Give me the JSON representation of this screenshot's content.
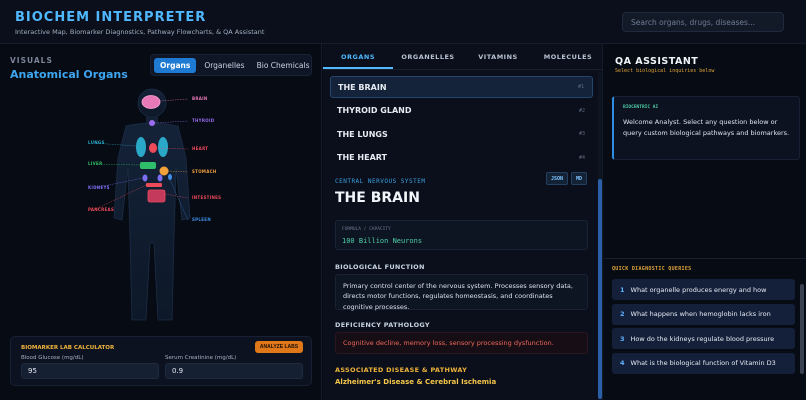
{
  "header": {
    "title": "BIOCHEM INTERPRETER",
    "subtitle": "Interactive Map, Biomarker Diagnostics, Pathway Flowcharts, & QA Assistant",
    "search_placeholder": "Search organs, drugs, diseases..."
  },
  "left": {
    "section_label": "VISUALS",
    "heading": "Anatomical Organs",
    "tabs": [
      "Organs",
      "Organelles",
      "Bio Chemicals"
    ],
    "active_tab": "Organs",
    "body_labels": {
      "brain": "BRAIN",
      "thyroid": "THYROID",
      "lungs": "LUNGS",
      "heart": "HEART",
      "liver": "LIVER",
      "stomach": "STOMACH",
      "kidneys": "KIDNEYS",
      "intestines": "INTESTINES",
      "pancreas": "PANCREAS",
      "spleen": "SPLEEN"
    },
    "colors": {
      "brain": "#e879b9",
      "thyroid": "#9b6cf0",
      "lungs": "#2aa8c8",
      "heart": "#ef4a5a",
      "liver": "#2fbf6a",
      "stomach": "#f2a23a",
      "kidneys": "#7c6ff2",
      "intestines": "#ef4a5a",
      "pancreas": "#ef4a5a",
      "spleen": "#3f8fe8"
    },
    "lab": {
      "title": "BIOMARKER LAB CALCULATOR",
      "analyze_label": "ANALYZE LABS",
      "glucose_label": "Blood Glucose (mg/dL)",
      "glucose_value": "95",
      "creatinine_label": "Serum Creatinine (mg/dL)",
      "creatinine_value": "0.9"
    }
  },
  "middle": {
    "tabs": [
      "ORGANS",
      "ORGANELLES",
      "VITAMINS",
      "MOLECULES"
    ],
    "active_tab": "ORGANS",
    "organ_list": [
      {
        "name": "THE BRAIN",
        "index": "#1"
      },
      {
        "name": "THYROID GLAND",
        "index": "#2"
      },
      {
        "name": "THE LUNGS",
        "index": "#3"
      },
      {
        "name": "THE HEART",
        "index": "#4"
      }
    ],
    "detail": {
      "system": "CENTRAL NERVOUS SYSTEM",
      "json_label": "JSON",
      "md_label": "MD",
      "title": "THE BRAIN",
      "formula_label": "FORMULA / CAPACITY",
      "formula_value": "100 Billion Neurons",
      "bio_heading": "BIOLOGICAL FUNCTION",
      "bio_text": "Primary control center of the nervous system. Processes sensory data, directs motor functions, regulates homeostasis, and coordinates cognitive processes.",
      "def_heading": "DEFICIENCY PATHOLOGY",
      "def_text": "Cognitive decline, memory loss, sensory processing dysfunction.",
      "disease_heading": "ASSOCIATED DISEASE & PATHWAY",
      "disease_name": "Alzheimer's Disease & Cerebral Ischemia"
    }
  },
  "right": {
    "title": "QA ASSISTANT",
    "subtitle": "Select biological inquiries below",
    "card_label": "BIOCENTRIC AI",
    "card_text": "Welcome Analyst. Select any question below or query custom biological pathways and biomarkers.",
    "quick_label": "QUICK DIAGNOSTIC QUERIES",
    "queries": [
      {
        "num": "1",
        "text": "What organelle produces energy and how"
      },
      {
        "num": "2",
        "text": "What happens when hemoglobin lacks iron"
      },
      {
        "num": "3",
        "text": "How do the kidneys regulate blood pressure"
      },
      {
        "num": "4",
        "text": "What is the biological function of Vitamin D3"
      }
    ]
  }
}
